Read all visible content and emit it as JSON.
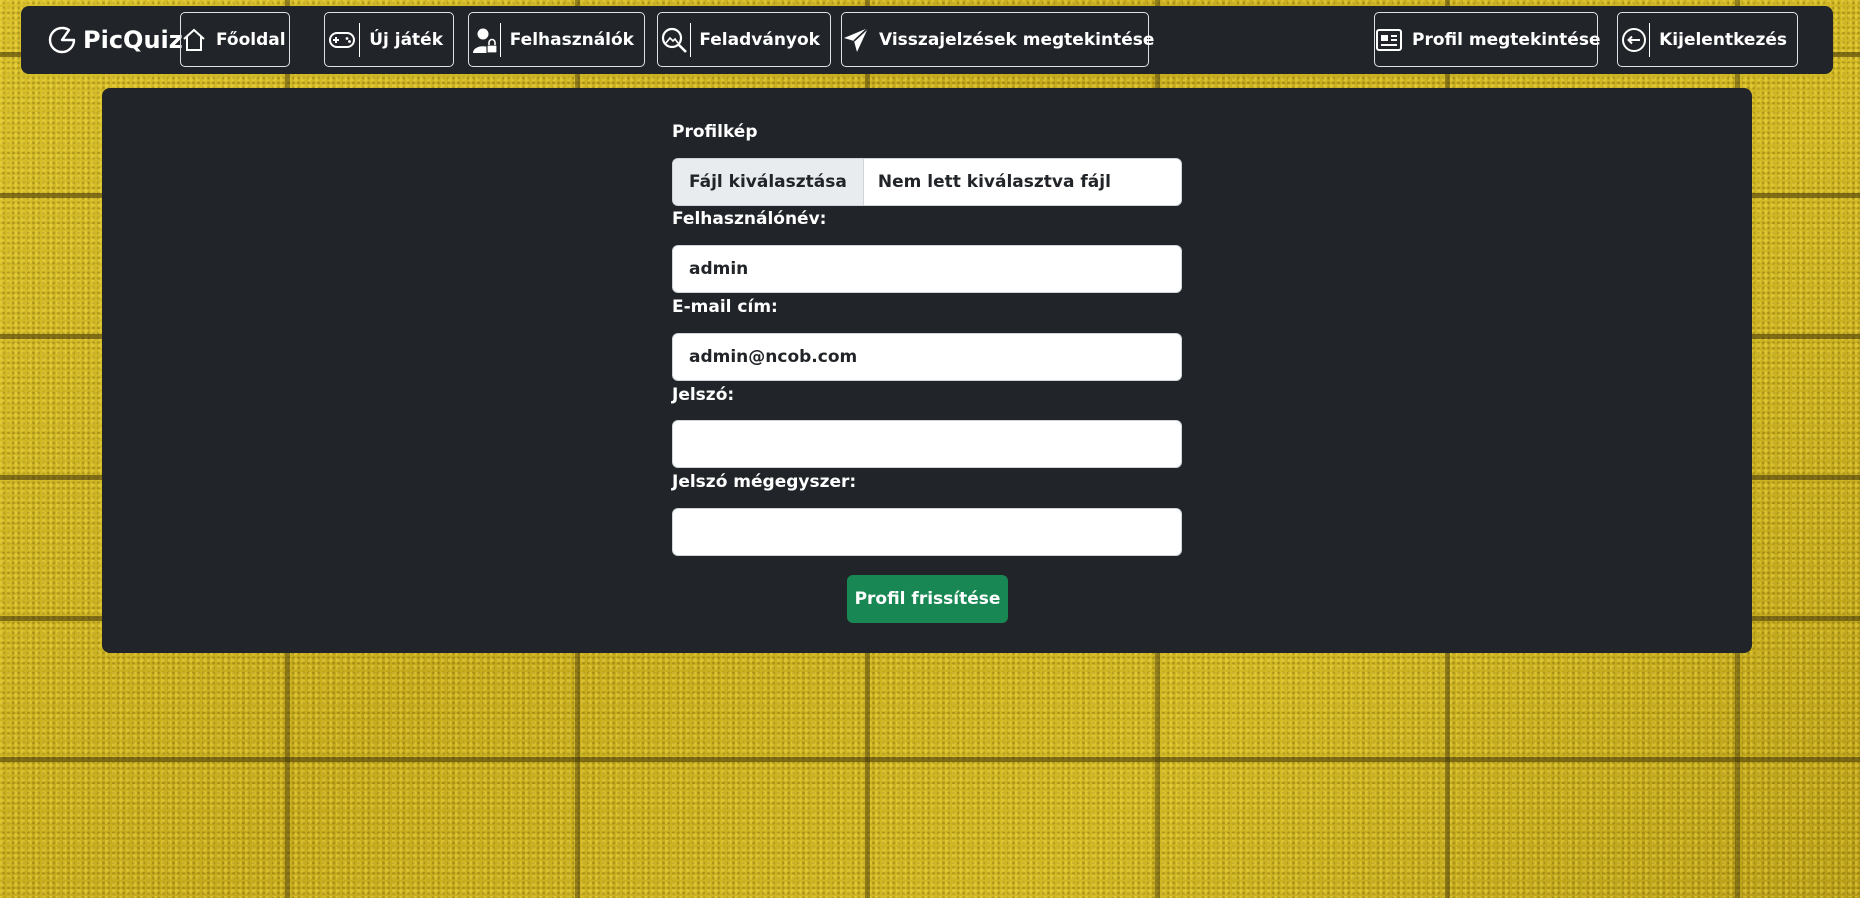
{
  "navbar": {
    "brand": "PicQuiz",
    "items": [
      {
        "label": "Főoldal",
        "icon": "home-icon"
      },
      {
        "label": "Új játék",
        "icon": "gamepad-icon"
      },
      {
        "label": "Felhasználók",
        "icon": "user-lock-icon"
      },
      {
        "label": "Feladványok",
        "icon": "search-image-icon"
      },
      {
        "label": "Visszajelzések megtekintése",
        "icon": "send-icon"
      }
    ],
    "right_items": [
      {
        "label": "Profil megtekintése",
        "icon": "profile-card-icon"
      },
      {
        "label": "Kijelentkezés",
        "icon": "logout-icon"
      }
    ]
  },
  "form": {
    "profile_pic_label": "Profilkép",
    "file_button_label": "Fájl kiválasztása",
    "file_status": "Nem lett kiválasztva fájl",
    "username_label": "Felhasználónév:",
    "username_value": "admin",
    "email_label": "E-mail cím:",
    "email_value": "admin@ncob.com",
    "password_label": "Jelszó:",
    "password_value": "",
    "password_confirm_label": "Jelszó mégegyszer:",
    "password_confirm_value": "",
    "submit_label": "Profil frissítése"
  },
  "colors": {
    "navbar_bg": "#212529",
    "panel_bg": "#212529",
    "submit_bg": "#198754",
    "background_brick": "#c9b11f"
  }
}
